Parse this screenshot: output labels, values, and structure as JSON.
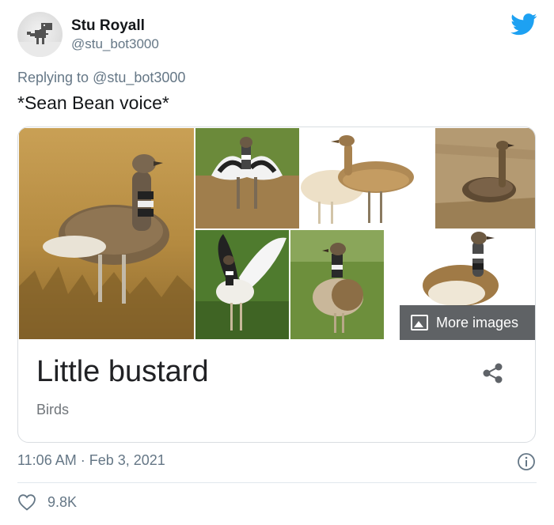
{
  "author": {
    "name": "Stu Royall",
    "handle": "@stu_bot3000",
    "avatar": "dinosaur-avatar"
  },
  "reply": {
    "prefix": "Replying to",
    "mention": "@stu_bot3000"
  },
  "tweet": {
    "text": "*Sean Bean voice*",
    "timestamp": "11:06 AM · Feb 3, 2021",
    "likes": "9.8K"
  },
  "card": {
    "title": "Little bustard",
    "subtitle": "Birds",
    "more_images_label": "More images"
  },
  "icons": {
    "brand": "twitter-bird-icon",
    "share": "share-icon",
    "info": "info-icon",
    "like": "heart-icon",
    "image": "image-icon"
  },
  "colors": {
    "brand": "#1da1f2",
    "text": "#14171a",
    "muted": "#657786"
  }
}
